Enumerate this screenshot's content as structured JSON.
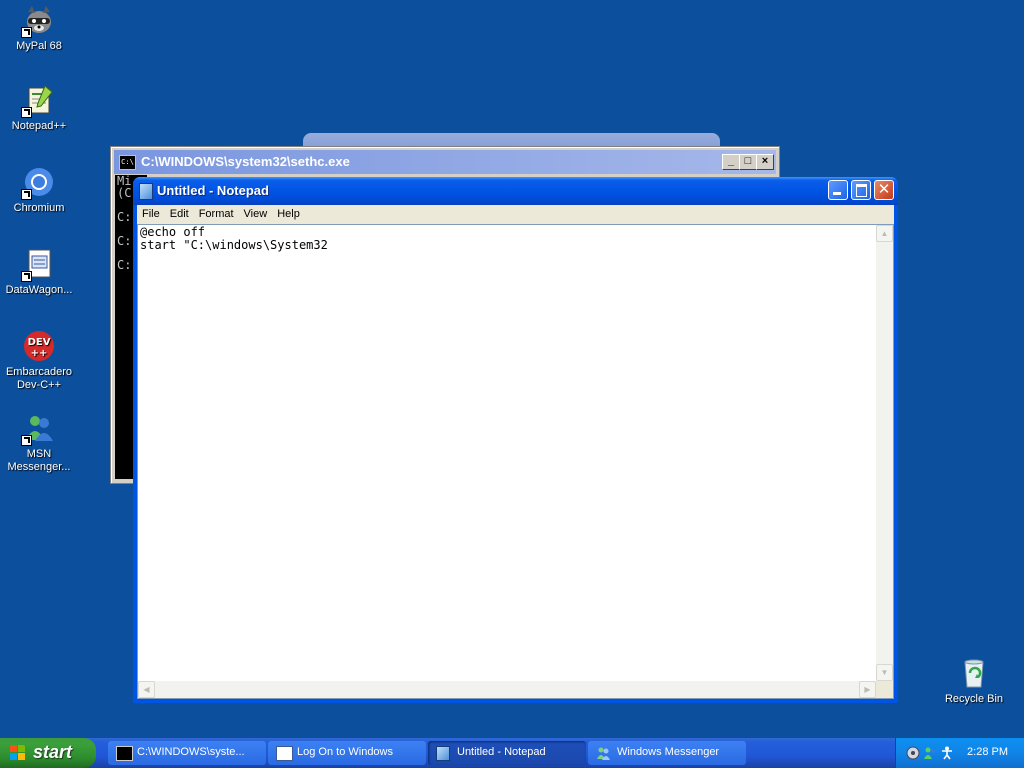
{
  "desktop": {
    "icons": [
      {
        "label": "MyPal 68"
      },
      {
        "label": "Notepad++"
      },
      {
        "label": "Chromium"
      },
      {
        "label": "DataWagon..."
      },
      {
        "label": "Embarcadero Dev-C++"
      },
      {
        "label": "MSN Messenger..."
      }
    ],
    "recycle_bin": {
      "label": "Recycle Bin"
    }
  },
  "cmd_window": {
    "title": "C:\\WINDOWS\\system32\\sethc.exe",
    "console_lines": [
      "Mi",
      "(C",
      "",
      "C:",
      "",
      "C:",
      "",
      "C:"
    ],
    "buttons": {
      "minimize": "_",
      "maximize": "□",
      "close": "×"
    }
  },
  "notepad": {
    "title": "Untitled - Notepad",
    "menu": [
      "File",
      "Edit",
      "Format",
      "View",
      "Help"
    ],
    "text": "@echo off\nstart \"C:\\windows\\System32"
  },
  "taskbar": {
    "start_label": "start",
    "tasks": [
      {
        "label": "C:\\WINDOWS\\syste...",
        "icon": "cmd-icon"
      },
      {
        "label": "Log On to Windows",
        "icon": "window-icon"
      },
      {
        "label": "Untitled - Notepad",
        "icon": "notepad-icon"
      },
      {
        "label": "Windows Messenger",
        "icon": "messenger-icon"
      }
    ],
    "clock": "2:28 PM"
  },
  "colors": {
    "desktop_bg": "#0c4f9c",
    "xp_blue": "#0054e3",
    "start_green": "#3aa03a"
  }
}
